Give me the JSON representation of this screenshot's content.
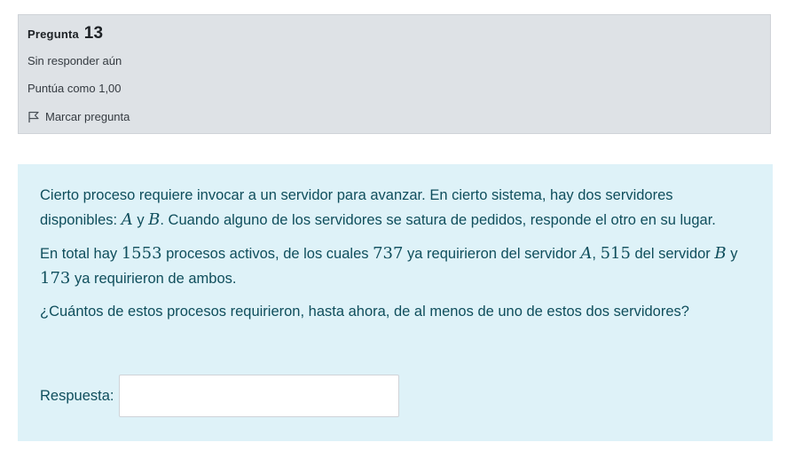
{
  "info": {
    "question_label": "Pregunta",
    "question_number": "13",
    "state": "Sin responder aún",
    "grade": "Puntúa como 1,00",
    "flag_label": "Marcar pregunta"
  },
  "question": {
    "p1_a": "Cierto proceso requiere invocar a un servidor para avanzar. En cierto sistema, hay dos servidores disponibles: ",
    "var_a": "A",
    "p1_b": " y ",
    "var_b": "B",
    "p1_c": ". Cuando alguno de los servidores se satura de pedidos, responde el otro en su lugar.",
    "p2_a": "En total hay ",
    "total": "1553",
    "p2_b": " procesos activos, de los cuales ",
    "count_a": "737",
    "p2_c": " ya requirieron del servidor ",
    "p2_d": ", ",
    "count_b": "515",
    "p2_e": " del servidor ",
    "p2_f": " y ",
    "count_both": "173",
    "p2_g": " ya requirieron de ambos.",
    "p3": "¿Cuántos de estos procesos requirieron, hasta ahora, de al menos de uno de estos dos servidores?"
  },
  "answer": {
    "label": "Respuesta:",
    "value": ""
  },
  "colors": {
    "info_bg": "#dee2e6",
    "formulation_bg": "#def2f8",
    "formulation_text": "#0f4e5c"
  }
}
